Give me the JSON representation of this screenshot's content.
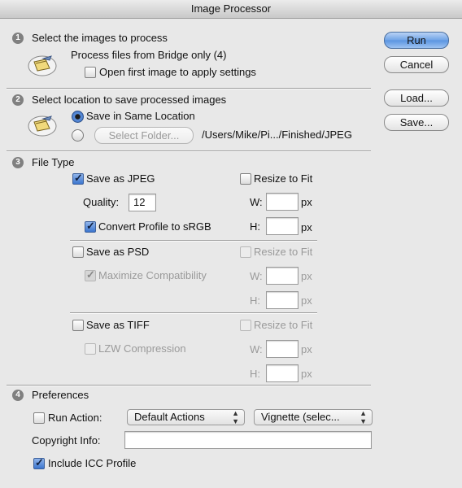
{
  "window": {
    "title": "Image Processor"
  },
  "section1": {
    "number": "1",
    "heading": "Select the images to process",
    "source_text": "Process files from Bridge only (4)",
    "open_first_label": "Open first image to apply settings",
    "open_first_checked": false
  },
  "section2": {
    "number": "2",
    "heading": "Select location to save processed images",
    "same_location_label": "Save in Same Location",
    "same_location_selected": true,
    "select_folder_label": "Select Folder...",
    "folder_path": "/Users/Mike/Pi.../Finished/JPEG"
  },
  "section3": {
    "number": "3",
    "heading": "File Type",
    "jpeg": {
      "save_label": "Save as JPEG",
      "save_checked": true,
      "quality_label": "Quality:",
      "quality_value": "12",
      "convert_label": "Convert Profile to sRGB",
      "convert_checked": true,
      "resize_label": "Resize to Fit",
      "resize_checked": false,
      "w_label": "W:",
      "h_label": "H:",
      "unit": "px"
    },
    "psd": {
      "save_label": "Save as PSD",
      "save_checked": false,
      "maximize_label": "Maximize Compatibility",
      "maximize_checked": true,
      "resize_label": "Resize to Fit",
      "w_label": "W:",
      "h_label": "H:",
      "unit": "px"
    },
    "tiff": {
      "save_label": "Save as TIFF",
      "save_checked": false,
      "lzw_label": "LZW Compression",
      "lzw_checked": false,
      "resize_label": "Resize to Fit",
      "w_label": "W:",
      "h_label": "H:",
      "unit": "px"
    }
  },
  "section4": {
    "number": "4",
    "heading": "Preferences",
    "run_action_label": "Run Action:",
    "run_action_checked": false,
    "action_set": "Default Actions",
    "action": "Vignette (selec...",
    "copyright_label": "Copyright Info:",
    "copyright_value": "",
    "icc_label": "Include ICC Profile",
    "icc_checked": true
  },
  "buttons": {
    "run": "Run",
    "cancel": "Cancel",
    "load": "Load...",
    "save": "Save..."
  },
  "icons": {
    "step_icon": "bridge-folder-icon"
  },
  "colors": {
    "accent": "#5a94e0",
    "background": "#e8e8e8"
  }
}
